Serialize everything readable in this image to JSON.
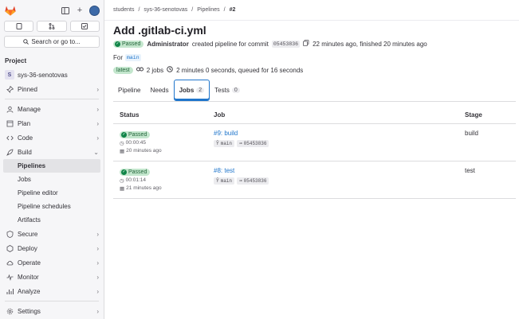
{
  "sidebar": {
    "search_label": "Search or go to...",
    "section_title": "Project",
    "project_initial": "S",
    "project_name": "sys-36-senotovas",
    "items": [
      {
        "label": "Pinned",
        "icon": "pin-icon"
      },
      {
        "label": "Manage",
        "icon": "users-icon"
      },
      {
        "label": "Plan",
        "icon": "plan-icon"
      },
      {
        "label": "Code",
        "icon": "code-icon"
      },
      {
        "label": "Build",
        "icon": "rocket-icon"
      }
    ],
    "build_sub": [
      "Pipelines",
      "Jobs",
      "Pipeline editor",
      "Pipeline schedules",
      "Artifacts"
    ],
    "items_after": [
      {
        "label": "Secure",
        "icon": "shield-icon"
      },
      {
        "label": "Deploy",
        "icon": "deploy-icon"
      },
      {
        "label": "Operate",
        "icon": "cloud-icon"
      },
      {
        "label": "Monitor",
        "icon": "monitor-icon"
      },
      {
        "label": "Analyze",
        "icon": "chart-icon"
      }
    ],
    "settings_label": "Settings"
  },
  "breadcrumb": [
    "students",
    "sys-36-senotovas",
    "Pipelines",
    "#2"
  ],
  "pipeline": {
    "title": "Add .gitlab-ci.yml",
    "status": "Passed",
    "author": "Administrator",
    "created_text": "created pipeline for commit",
    "commit": "05453836",
    "timing": "22 minutes ago, finished 20 minutes ago",
    "for_label": "For",
    "branch": "main",
    "latest_label": "latest",
    "jobs_count_text": "2 jobs",
    "duration_text": "2 minutes 0 seconds, queued for 16 seconds"
  },
  "tabs": [
    {
      "label": "Pipeline",
      "count": ""
    },
    {
      "label": "Needs",
      "count": ""
    },
    {
      "label": "Jobs",
      "count": "2"
    },
    {
      "label": "Tests",
      "count": "0"
    }
  ],
  "table": {
    "headers": [
      "Status",
      "Job",
      "Stage"
    ],
    "rows": [
      {
        "status": "Passed",
        "duration": "00:00:45",
        "ago": "20 minutes ago",
        "job": "#9: build",
        "branch": "main",
        "commit": "05453836",
        "stage": "build"
      },
      {
        "status": "Passed",
        "duration": "00:01:14",
        "ago": "21 minutes ago",
        "job": "#8: test",
        "branch": "main",
        "commit": "05453836",
        "stage": "test"
      }
    ]
  },
  "colors": {
    "accent": "#1f75cb",
    "success": "#108548",
    "success_bg": "#c3e6cd"
  }
}
